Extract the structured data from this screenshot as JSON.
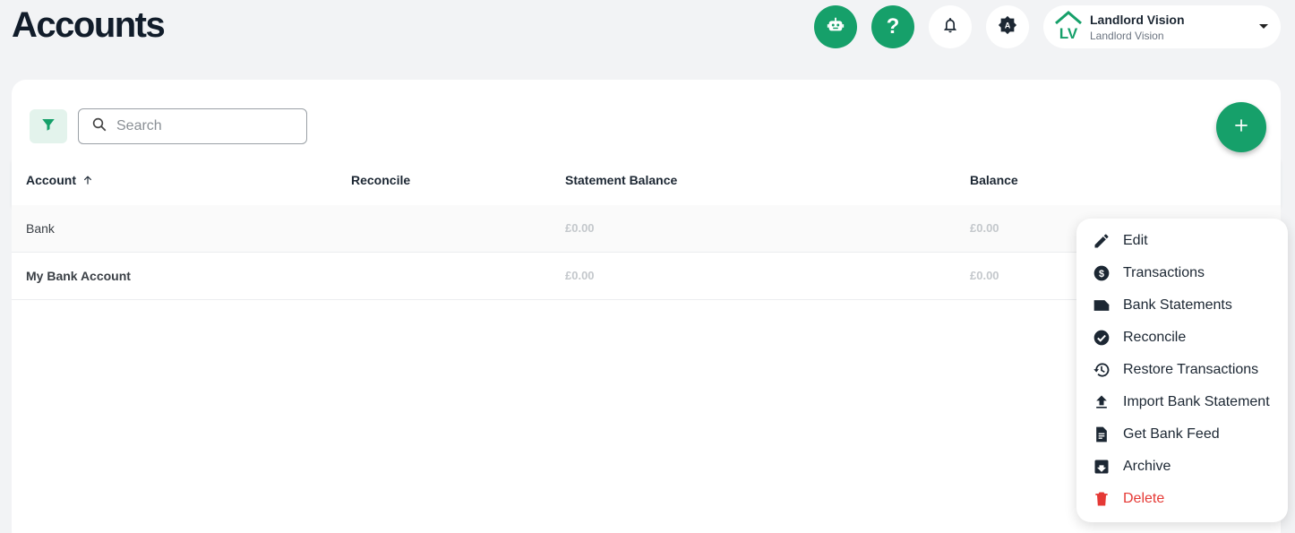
{
  "header": {
    "title": "Accounts",
    "buttons": [
      {
        "icon": "robot-icon"
      },
      {
        "icon": "help-icon",
        "glyph": "?"
      },
      {
        "icon": "bell-icon"
      },
      {
        "icon": "theme-auto-icon",
        "glyph": "A"
      }
    ],
    "account": {
      "name": "Landlord Vision",
      "subtitle": "Landlord Vision",
      "logo_text": "LV"
    }
  },
  "toolbar": {
    "search_placeholder": "Search",
    "filter_icon": "filter-icon",
    "add_icon": "plus-icon"
  },
  "table": {
    "columns": [
      "Account",
      "Reconcile",
      "Statement Balance",
      "Balance"
    ],
    "sort_icon": "arrow-up-icon",
    "rows": [
      {
        "account": "Bank",
        "reconcile": "",
        "statement_balance": "£0.00",
        "balance": "£0.00"
      },
      {
        "account": "My Bank Account",
        "reconcile": "",
        "statement_balance": "£0.00",
        "balance": "£0.00"
      }
    ]
  },
  "menu": {
    "items": [
      {
        "label": "Edit",
        "icon": "pencil-icon"
      },
      {
        "label": "Transactions",
        "icon": "dollar-icon"
      },
      {
        "label": "Bank Statements",
        "icon": "statement-icon"
      },
      {
        "label": "Reconcile",
        "icon": "check-circle-icon"
      },
      {
        "label": "Restore Transactions",
        "icon": "history-icon"
      },
      {
        "label": "Import Bank Statement",
        "icon": "upload-icon"
      },
      {
        "label": "Get Bank Feed",
        "icon": "document-icon"
      },
      {
        "label": "Archive",
        "icon": "archive-icon"
      },
      {
        "label": "Delete",
        "icon": "trash-icon"
      }
    ]
  },
  "colors": {
    "brand_green": "#16a06a",
    "danger": "#e53935",
    "muted_money": "#c4c8cc"
  }
}
